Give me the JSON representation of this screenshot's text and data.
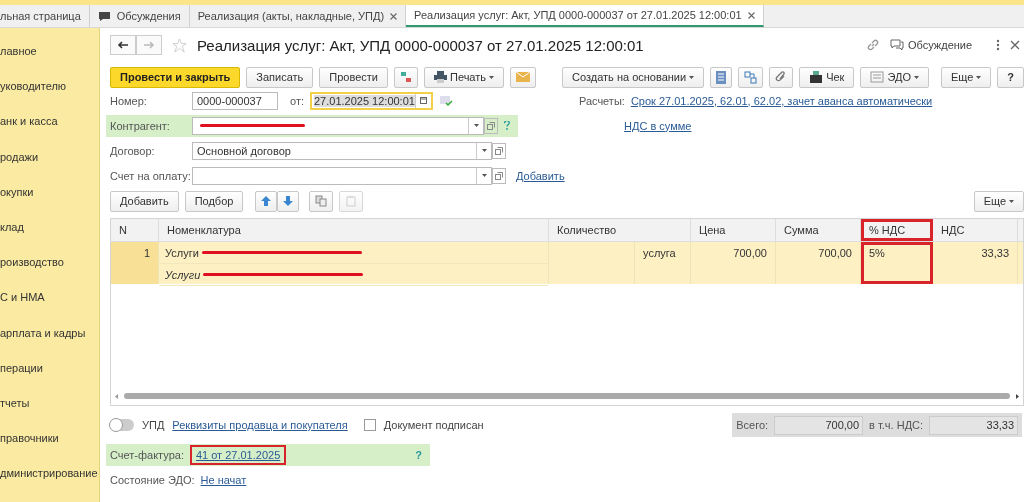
{
  "tabs": [
    {
      "label": "льная страница",
      "icon": false,
      "closable": false,
      "selected": false
    },
    {
      "label": "Обсуждения",
      "icon": true,
      "closable": false,
      "selected": false
    },
    {
      "label": "Реализация (акты, накладные, УПД)",
      "icon": false,
      "closable": true,
      "selected": false
    },
    {
      "label": "Реализация услуг: Акт, УПД 0000-000037 от 27.01.2025 12:00:01",
      "icon": false,
      "closable": true,
      "selected": true
    }
  ],
  "sidebar": {
    "items": [
      "лавное",
      "уководителю",
      "анк и касса",
      "родажи",
      "окупки",
      "клад",
      "роизводство",
      "С и НМА",
      "арплата и кадры",
      "перации",
      "тчеты",
      "правочники",
      "дминистрирование"
    ]
  },
  "title": "Реализация услуг: Акт, УПД 0000-000037 от 27.01.2025 12:00:01",
  "discussion": "Обсуждение",
  "toolbar": {
    "post_close": "Провести и закрыть",
    "save": "Записать",
    "post": "Провести",
    "print": "Печать",
    "create_based": "Создать на основании",
    "check": "Чек",
    "edo": "ЭДО",
    "more": "Еще",
    "help": "?"
  },
  "fields": {
    "number_label": "Номер:",
    "number": "0000-000037",
    "date_label": "от:",
    "date": "27.01.2025 12:00:01",
    "settlements_label": "Расчеты:",
    "settlements_link": "Срок 27.01.2025, 62.01, 62.02, зачет аванса автоматически",
    "counterparty_label": "Контрагент:",
    "counterparty_redacted": true,
    "vat_link": "НДС в сумме",
    "contract_label": "Договор:",
    "contract": "Основной договор",
    "invoice_label": "Счет на оплату:",
    "invoice_add": "Добавить"
  },
  "table_toolbar": {
    "add": "Добавить",
    "pick": "Подбор",
    "more": "Еще"
  },
  "table": {
    "columns": [
      {
        "label": "N",
        "highlighted": false
      },
      {
        "label": "Номенклатура",
        "highlighted": false
      },
      {
        "label": "Количество",
        "highlighted": false
      },
      {
        "label": "Цена",
        "highlighted": false
      },
      {
        "label": "Сумма",
        "highlighted": false
      },
      {
        "label": "% НДС",
        "highlighted": true
      },
      {
        "label": "НДС",
        "highlighted": false
      }
    ],
    "rows": [
      {
        "n": "1",
        "item": "Услуги",
        "item_redacted": true,
        "content": "Услуги",
        "content_redacted": true,
        "quantity_unit": "услуга",
        "price": "700,00",
        "sum": "700,00",
        "vat_rate": "5%",
        "vat": "33,33",
        "selected": true
      }
    ]
  },
  "footer": {
    "upd_on": false,
    "upd_label": "УПД",
    "requisites_link": "Реквизиты продавца и покупателя",
    "signed": false,
    "signed_label": "Документ подписан",
    "total_label": "Всего:",
    "total": "700,00",
    "vat_label": "в т.ч. НДС:",
    "vat": "33,33",
    "sf_label": "Счет-фактура:",
    "sf_link": "41 от 27.01.2025",
    "sf_highlighted": true,
    "sf_help": "?",
    "edo_label": "Состояние ЭДО:",
    "edo_link": "Не начат"
  }
}
